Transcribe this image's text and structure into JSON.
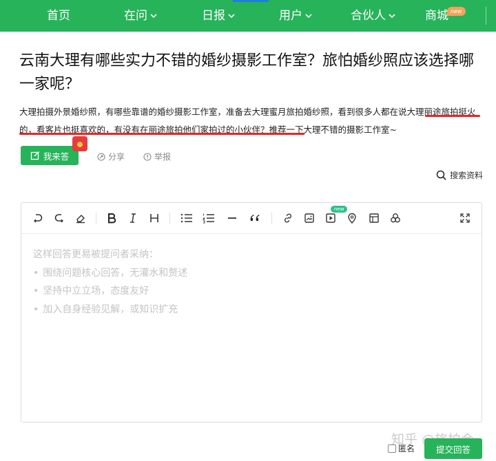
{
  "nav": {
    "items": [
      {
        "label": "首页",
        "has_dropdown": false
      },
      {
        "label": "在问",
        "has_dropdown": true
      },
      {
        "label": "日报",
        "has_dropdown": true
      },
      {
        "label": "用户",
        "has_dropdown": true
      },
      {
        "label": "合伙人",
        "has_dropdown": true
      },
      {
        "label": "商城",
        "has_dropdown": false
      }
    ],
    "mall_badge": "new",
    "colors": {
      "bar": "#27b35a",
      "active_indicator": "#1f7fd6"
    }
  },
  "question": {
    "title": "云南大理有哪些实力不错的婚纱摄影工作室？旅怕婚纱照应该选择哪一家呢？",
    "description_part1": "大理拍摄外景婚纱照，有哪些靠谱的婚纱摄影工作室，准备去大理蜜月旅拍婚纱照，看到很多人都在说",
    "description_mark1": "大理丽途旅",
    "description_mark2": "拍挺火的，看客片也挺喜欢的，有没有在丽途旅拍他们家拍过的小伙伴",
    "description_part2": "？推荐一下大理不错的摄影工作室~"
  },
  "actions": {
    "answer_label": "我来答",
    "share_label": "分享",
    "report_label": "举报",
    "search_label": "搜索资料"
  },
  "editor": {
    "toolbar_icons": [
      "undo-icon",
      "redo-icon",
      "eraser-icon",
      "bold-icon",
      "italic-icon",
      "heading-icon",
      "bullet-list-icon",
      "numbered-list-icon",
      "divider-icon",
      "quote-icon",
      "link-icon",
      "image-icon",
      "video-icon",
      "location-icon",
      "table-icon",
      "emoji-icon",
      "fullscreen-icon"
    ],
    "toolbar_new_badge": "new",
    "placeholder_heading": "这样回答更易被提问者采纳：",
    "placeholder_tips": [
      "围绕问题核心回答，无灌水和赘述",
      "坚持中立立场，态度友好",
      "加入自身经验见解，或知识扩充"
    ]
  },
  "footer": {
    "anonymous_label": "匿名",
    "submit_label": "提交回答",
    "watermark": "知乎 @旅拍会"
  }
}
